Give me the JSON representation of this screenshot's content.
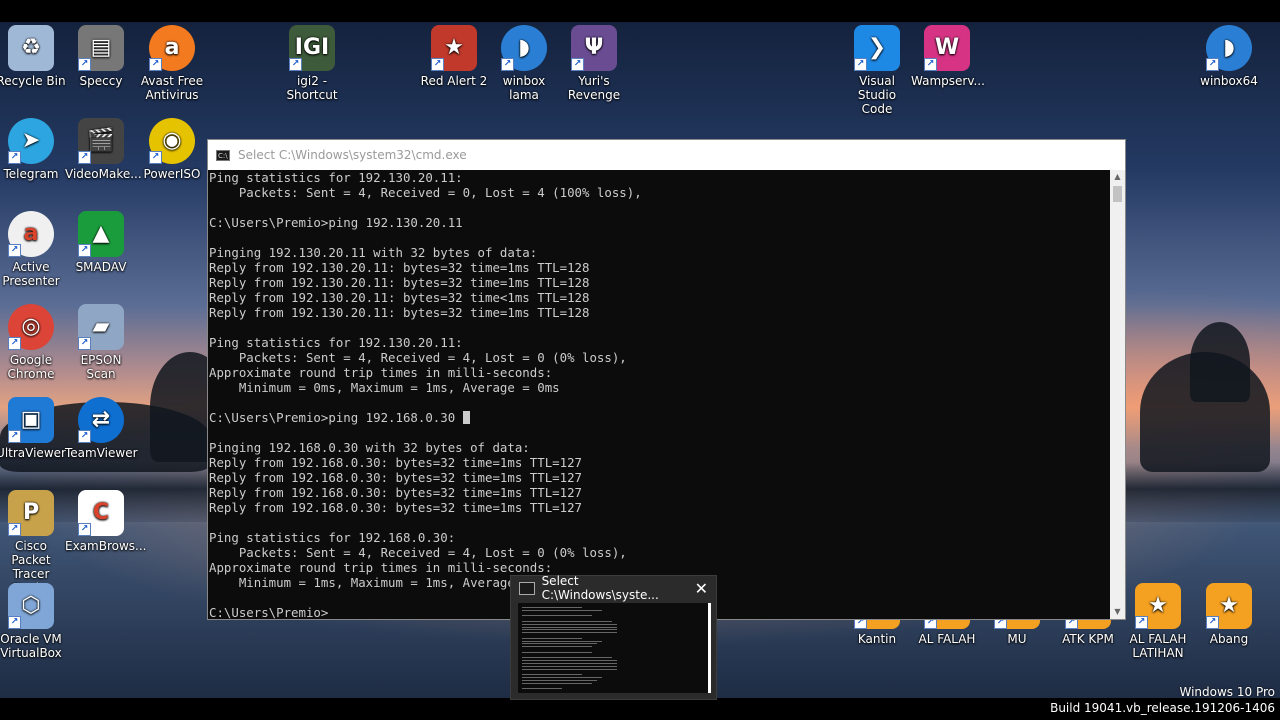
{
  "desktop_icons": [
    {
      "label": "Recycle Bin",
      "icon": "recycle-bin-icon",
      "color": "#9fb8d6",
      "glyph": "♻"
    },
    {
      "label": "Speccy",
      "icon": "speccy-icon",
      "color": "#777777",
      "glyph": "▤"
    },
    {
      "label": "Avast Free Antivirus",
      "icon": "avast-icon",
      "color": "#f47a20",
      "glyph": "a"
    },
    {
      "label": "igi2 - Shortcut",
      "icon": "igi2-icon",
      "color": "#3d5a3a",
      "glyph": "IGI"
    },
    {
      "label": "Red Alert 2",
      "icon": "red-alert-icon",
      "color": "#c0392b",
      "glyph": "★"
    },
    {
      "label": "winbox lama",
      "icon": "winbox-icon",
      "color": "#2a7fd4",
      "glyph": "◗"
    },
    {
      "label": "Yuri's Revenge",
      "icon": "yuri-icon",
      "color": "#6a4c93",
      "glyph": "Ψ"
    },
    {
      "label": "Visual Studio Code",
      "icon": "vscode-icon",
      "color": "#1e88e5",
      "glyph": "❯"
    },
    {
      "label": "Wampserv...",
      "icon": "wampserver-icon",
      "color": "#d63384",
      "glyph": "W"
    },
    {
      "label": "winbox64",
      "icon": "winbox64-icon",
      "color": "#2a7fd4",
      "glyph": "◗"
    },
    {
      "label": "Telegram",
      "icon": "telegram-icon",
      "color": "#2ca5e0",
      "glyph": "➤"
    },
    {
      "label": "VideoMake...",
      "icon": "video-maker-icon",
      "color": "#444444",
      "glyph": "🎬"
    },
    {
      "label": "PowerISO",
      "icon": "poweriso-icon",
      "color": "#e6c300",
      "glyph": "◉"
    },
    {
      "label": "Active Presenter",
      "icon": "active-presenter-icon",
      "color": "#f0f0f0",
      "glyph": "a"
    },
    {
      "label": "SMADAV",
      "icon": "smadav-icon",
      "color": "#1a9c3c",
      "glyph": "▲"
    },
    {
      "label": "Google Chrome",
      "icon": "chrome-icon",
      "color": "#db4437",
      "glyph": "◎"
    },
    {
      "label": "EPSON Scan",
      "icon": "epson-scan-icon",
      "color": "#8fa7c4",
      "glyph": "▰"
    },
    {
      "label": "UltraViewer",
      "icon": "ultraviewer-icon",
      "color": "#1f7ad6",
      "glyph": "▣"
    },
    {
      "label": "TeamViewer",
      "icon": "teamviewer-icon",
      "color": "#0e6fd1",
      "glyph": "⇄"
    },
    {
      "label": "Cisco Packet Tracer Stud...",
      "icon": "packet-tracer-icon",
      "color": "#c8a24a",
      "glyph": "P"
    },
    {
      "label": "ExamBrows...",
      "icon": "exambrowser-icon",
      "color": "#ffffff",
      "glyph": "C"
    },
    {
      "label": "Oracle VM VirtualBox",
      "icon": "virtualbox-icon",
      "color": "#7fa6d6",
      "glyph": "⬡"
    },
    {
      "label": "Kantin",
      "icon": "kantin-icon",
      "color": "#f4a020",
      "glyph": "★"
    },
    {
      "label": "AL FALAH",
      "icon": "al-falah-icon",
      "color": "#f4a020",
      "glyph": "★"
    },
    {
      "label": "MU",
      "icon": "mu-icon",
      "color": "#f4a020",
      "glyph": "★"
    },
    {
      "label": "ATK KPM",
      "icon": "atk-kpm-icon",
      "color": "#f4a020",
      "glyph": "★"
    },
    {
      "label": "AL FALAH LATIHAN",
      "icon": "al-falah-latihan-icon",
      "color": "#f4a020",
      "glyph": "★"
    },
    {
      "label": "Abang",
      "icon": "abang-icon",
      "color": "#f4a020",
      "glyph": "★"
    }
  ],
  "cmd_window": {
    "title": "Select C:\\Windows\\system32\\cmd.exe",
    "lines": [
      "Ping statistics for 192.130.20.11:",
      "    Packets: Sent = 4, Received = 0, Lost = 4 (100% loss),",
      "",
      "C:\\Users\\Premio>ping 192.130.20.11",
      "",
      "Pinging 192.130.20.11 with 32 bytes of data:",
      "Reply from 192.130.20.11: bytes=32 time=1ms TTL=128",
      "Reply from 192.130.20.11: bytes=32 time=1ms TTL=128",
      "Reply from 192.130.20.11: bytes=32 time<1ms TTL=128",
      "Reply from 192.130.20.11: bytes=32 time=1ms TTL=128",
      "",
      "Ping statistics for 192.130.20.11:",
      "    Packets: Sent = 4, Received = 4, Lost = 0 (0% loss),",
      "Approximate round trip times in milli-seconds:",
      "    Minimum = 0ms, Maximum = 1ms, Average = 0ms",
      "",
      "C:\\Users\\Premio>ping 192.168.0.30 ",
      "",
      "Pinging 192.168.0.30 with 32 bytes of data:",
      "Reply from 192.168.0.30: bytes=32 time=1ms TTL=127",
      "Reply from 192.168.0.30: bytes=32 time=1ms TTL=127",
      "Reply from 192.168.0.30: bytes=32 time=1ms TTL=127",
      "Reply from 192.168.0.30: bytes=32 time=1ms TTL=127",
      "",
      "Ping statistics for 192.168.0.30:",
      "    Packets: Sent = 4, Received = 4, Lost = 0 (0% loss),",
      "Approximate round trip times in milli-seconds:",
      "    Minimum = 1ms, Maximum = 1ms, Average",
      "",
      "C:\\Users\\Premio>"
    ]
  },
  "taskbar_preview": {
    "title": "Select C:\\Windows\\syste...",
    "close_glyph": "✕"
  },
  "watermark": {
    "line1": "Windows 10 Pro",
    "line2": "Build 19041.vb_release.191206-1406"
  }
}
